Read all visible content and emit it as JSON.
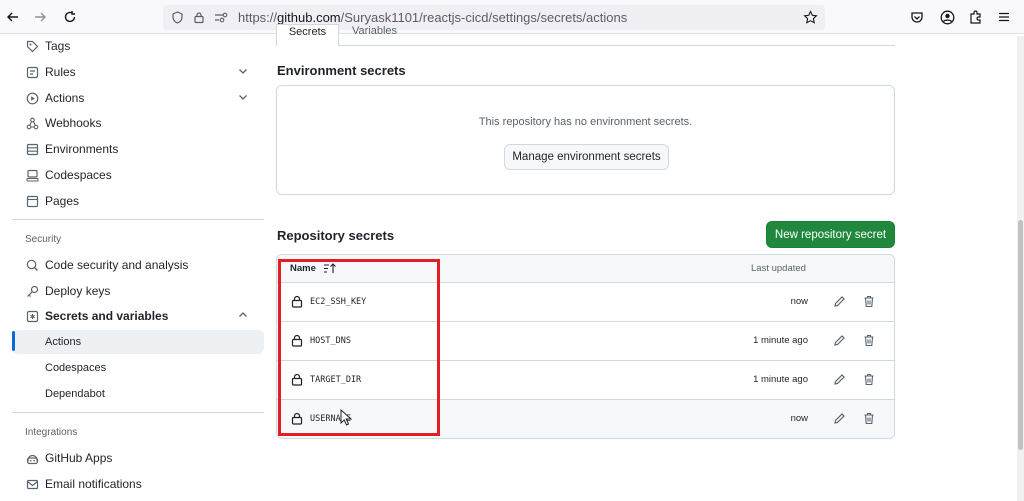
{
  "browser": {
    "url_prefix": "https://",
    "url_domain": "github.com",
    "url_path": "/Suryask1101/reactjs-cicd/settings/secrets/actions"
  },
  "tabs": {
    "secrets": "Secrets",
    "variables": "Variables"
  },
  "sidebar": {
    "items": [
      {
        "label": "Tags",
        "icon": "tag-icon"
      },
      {
        "label": "Rules",
        "icon": "rules-icon"
      },
      {
        "label": "Actions",
        "icon": "play-icon"
      },
      {
        "label": "Webhooks",
        "icon": "webhook-icon"
      },
      {
        "label": "Environments",
        "icon": "server-icon"
      },
      {
        "label": "Codespaces",
        "icon": "codespaces-icon"
      },
      {
        "label": "Pages",
        "icon": "browser-icon"
      }
    ],
    "security_heading": "Security",
    "security_items": [
      {
        "label": "Code security and analysis",
        "icon": "codescan-icon"
      },
      {
        "label": "Deploy keys",
        "icon": "key-icon"
      },
      {
        "label": "Secrets and variables",
        "icon": "asterisk-icon"
      }
    ],
    "sub_items": [
      "Actions",
      "Codespaces",
      "Dependabot"
    ],
    "integrations_heading": "Integrations",
    "integrations_items": [
      {
        "label": "GitHub Apps",
        "icon": "apps-icon"
      },
      {
        "label": "Email notifications",
        "icon": "mail-icon"
      }
    ]
  },
  "environment": {
    "heading": "Environment secrets",
    "empty_message": "This repository has no environment secrets.",
    "manage_button": "Manage environment secrets"
  },
  "repository": {
    "heading": "Repository secrets",
    "new_button": "New repository secret",
    "col_name": "Name",
    "col_updated": "Last updated",
    "secrets": [
      {
        "name": "EC2_SSH_KEY",
        "updated": "now"
      },
      {
        "name": "HOST_DNS",
        "updated": "1 minute ago"
      },
      {
        "name": "TARGET_DIR",
        "updated": "1 minute ago"
      },
      {
        "name": "USERNAME",
        "updated": "now"
      }
    ]
  },
  "colors": {
    "primary_green": "#1f883d",
    "accent_blue": "#0969da",
    "highlight_red": "#e31e24"
  }
}
